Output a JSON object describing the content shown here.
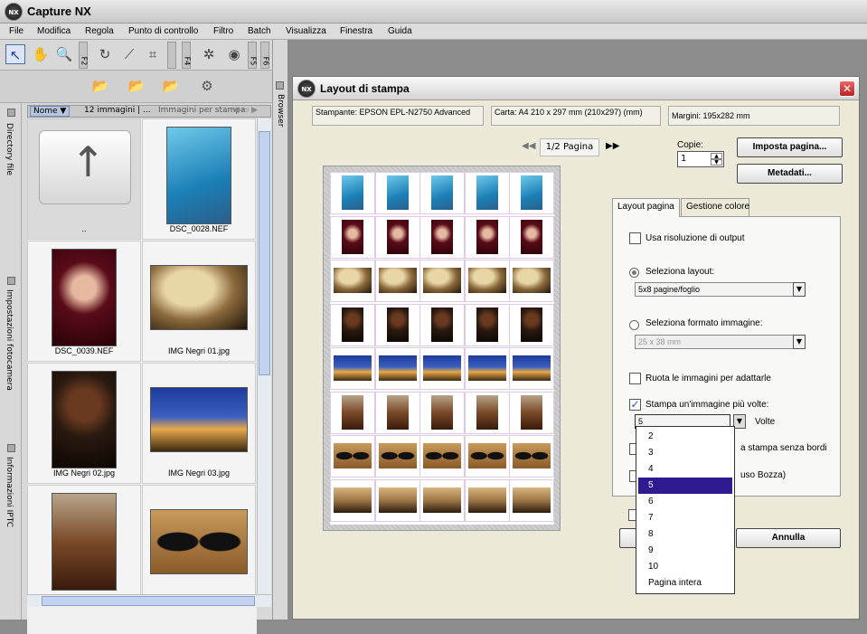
{
  "app": {
    "title": "Capture NX",
    "logo": "NX"
  },
  "menu": [
    "File",
    "Modifica",
    "Regola",
    "Punto di controllo",
    "Filtro",
    "Batch",
    "Visualizza",
    "Finestra",
    "Guida"
  ],
  "toolbar": {
    "f2": "F2",
    "f4": "F4",
    "f5": "F5",
    "f6": "F6"
  },
  "side_panels": {
    "directory": "Directory file",
    "camera": "Impostazioni fotocamera",
    "iptc": "Informazioni IPTC",
    "browser": "Browser"
  },
  "browser": {
    "sort_label": "Nome ▼",
    "count_label": "12 immagini | ...",
    "view_label": "Immagini per stampa",
    "thumbnails": [
      {
        "caption": "..",
        "selected": true
      },
      {
        "caption": "DSC_0028.NEF"
      },
      {
        "caption": "DSC_0039.NEF"
      },
      {
        "caption": "IMG Negri 01.jpg"
      },
      {
        "caption": "IMG Negri 02.jpg"
      },
      {
        "caption": "IMG Negri 03.jpg"
      },
      {
        "caption": ""
      },
      {
        "caption": ""
      }
    ]
  },
  "dialog": {
    "logo": "NX",
    "title": "Layout di stampa",
    "close": "✕",
    "printer": "Stampante:  EPSON EPL-N2750 Advanced",
    "paper": "Carta:  A4 210 x 297 mm (210x297) (mm)",
    "margins": "Margini:  195x282 mm",
    "prev": "◀◀",
    "next": "▶▶",
    "page_label": "1/2 Pagina",
    "copies_label": "Copie:",
    "copies_value": "1",
    "setup_button": "Imposta pagina...",
    "metadata_button": "Metadati...",
    "tabs": [
      "Layout pagina",
      "Gestione colore"
    ],
    "options": {
      "use_output_res": "Usa risoluzione di output",
      "select_layout": "Seleziona layout:",
      "layout_value": "5x8 pagine/foglio",
      "select_format": "Seleziona formato immagine:",
      "format_value": "25 x 38 mm",
      "rotate": "Ruota le immagini per adattarle",
      "print_multiple": "Stampa un'immagine più volte:",
      "times_value": "5",
      "times_label": "Volte",
      "borderless_partial": "a stampa senza bordi",
      "draft_partial": "uso Bozza)"
    },
    "cancel_button": "Annulla",
    "dropdown": [
      "2",
      "3",
      "4",
      "5",
      "6",
      "7",
      "8",
      "9",
      "10",
      "Pagina intera"
    ],
    "dropdown_selected": "5",
    "row_images": [
      "pool",
      "red",
      "hat",
      "dark",
      "pagoda",
      "monks",
      "arches",
      "sunset"
    ]
  },
  "colors": {
    "selection": "#2f1a8f",
    "check": "#2a4fd0",
    "close": "#cc3333"
  }
}
